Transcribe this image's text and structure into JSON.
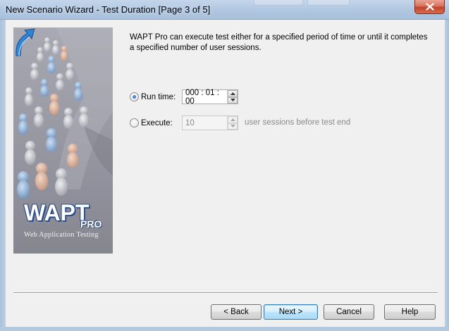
{
  "window": {
    "title": "New Scenario Wizard - Test Duration [Page 3 of 5]"
  },
  "banner": {
    "logo_main": "WAPT",
    "logo_pro": "PRO",
    "logo_subtitle": "Web Application Testing"
  },
  "content": {
    "intro": "WAPT Pro can execute test either for a specified period of time or until it completes a specified number of user sessions.",
    "run_time": {
      "label": "Run time:",
      "selected": true,
      "value": "000 : 01 : 00"
    },
    "execute": {
      "label": "Execute:",
      "selected": false,
      "value": "10",
      "suffix": "user sessions before test end"
    }
  },
  "buttons": {
    "back": "< Back",
    "next": "Next >",
    "cancel": "Cancel",
    "help": "Help"
  },
  "colors": {
    "accent": "#3c7fb1",
    "title_bar": "#b3c9e2",
    "close": "#c24329"
  }
}
